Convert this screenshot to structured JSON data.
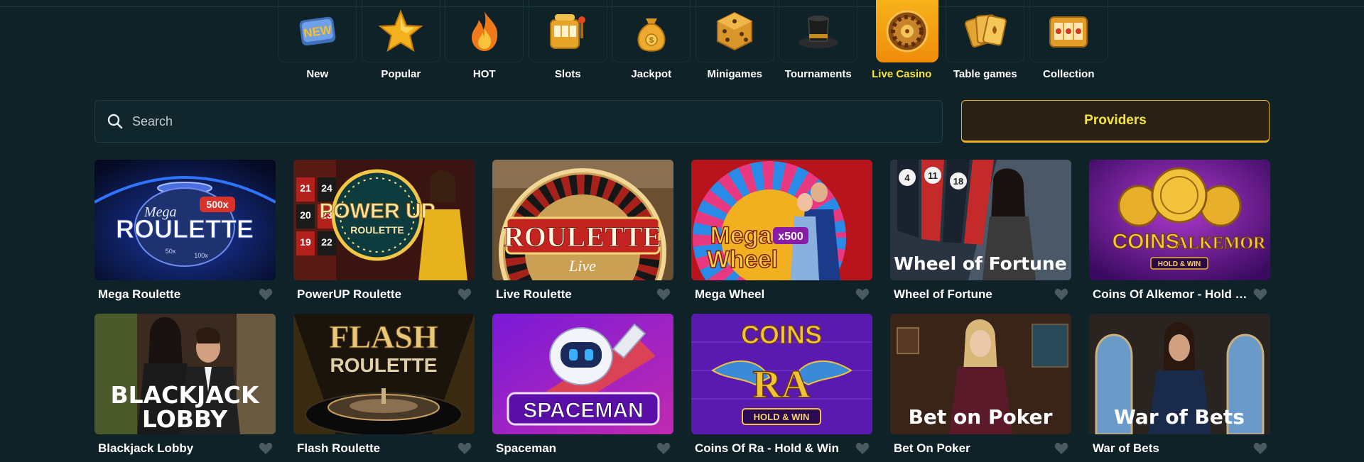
{
  "categories": [
    {
      "label": "New",
      "icon": "new-badge-icon"
    },
    {
      "label": "Popular",
      "icon": "star-icon"
    },
    {
      "label": "HOT",
      "icon": "fire-icon"
    },
    {
      "label": "Slots",
      "icon": "slot-machine-icon"
    },
    {
      "label": "Jackpot",
      "icon": "money-bag-icon"
    },
    {
      "label": "Minigames",
      "icon": "dice-icon"
    },
    {
      "label": "Tournaments",
      "icon": "top-hat-icon"
    },
    {
      "label": "Live Casino",
      "icon": "roulette-wheel-icon",
      "active": true
    },
    {
      "label": "Table games",
      "icon": "playing-cards-icon"
    },
    {
      "label": "Collection",
      "icon": "collection-slot-icon"
    }
  ],
  "search": {
    "placeholder": "Search"
  },
  "providers": {
    "label": "Providers"
  },
  "games": [
    {
      "title": "Mega Roulette",
      "art_text": [
        "Mega",
        "ROULETTE",
        "500x",
        "50x",
        "100x"
      ]
    },
    {
      "title": "PowerUP Roulette",
      "art_text": [
        "POWER UP",
        "ROULETTE",
        "21",
        "24",
        "20",
        "23",
        "19",
        "22"
      ]
    },
    {
      "title": "Live Roulette",
      "art_text": [
        "ROULETTE",
        "Live"
      ]
    },
    {
      "title": "Mega Wheel",
      "art_text": [
        "Mega",
        "Wheel",
        "x500"
      ]
    },
    {
      "title": "Wheel of Fortune",
      "art_text": [
        "Wheel of Fortune",
        "4",
        "11",
        "18"
      ]
    },
    {
      "title": "Coins Of Alkemor - Hold & Win",
      "art_text": [
        "COINS",
        "ALKEMOR",
        "HOLD & WIN"
      ]
    },
    {
      "title": "Blackjack Lobby",
      "art_text": [
        "BLACKJACK",
        "LOBBY"
      ]
    },
    {
      "title": "Flash Roulette",
      "art_text": [
        "FLASH",
        "ROULETTE"
      ]
    },
    {
      "title": "Spaceman",
      "art_text": [
        "SPACEMAN"
      ]
    },
    {
      "title": "Coins Of Ra - Hold & Win",
      "art_text": [
        "COINS",
        "RA",
        "HOLD & WIN"
      ]
    },
    {
      "title": "Bet On Poker",
      "art_text": [
        "Bet on Poker"
      ]
    },
    {
      "title": "War of Bets",
      "art_text": [
        "War of Bets"
      ]
    }
  ],
  "colors": {
    "background": "#0f2228",
    "accent": "#f6e43b",
    "active_tile": "#f7a415"
  }
}
